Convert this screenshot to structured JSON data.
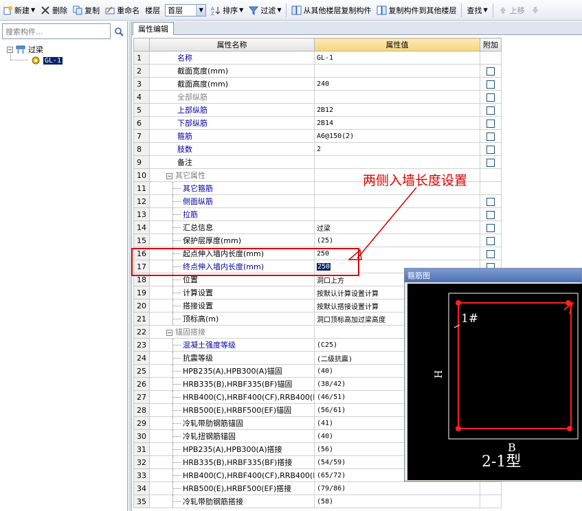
{
  "toolbar": {
    "new_label": "新建",
    "delete_label": "删除",
    "copy_label": "复制",
    "rename_label": "重命名",
    "floor_label": "楼层",
    "floor_value": "首层",
    "sort_label": "排序",
    "filter_label": "过滤",
    "copy_from_label": "从其他楼层复制构件",
    "copy_to_label": "复制构件到其他楼层",
    "find_label": "查找",
    "move_up_label": "上移"
  },
  "left_panel": {
    "search_placeholder": "搜索构件...",
    "tree_root": "过梁",
    "tree_child": "GL-1"
  },
  "tab": {
    "label": "属性编辑"
  },
  "grid": {
    "col_name": "属性名称",
    "col_value": "属性值",
    "col_extra": "附加",
    "rows": [
      {
        "n": "1",
        "name": "名称",
        "value": "GL-1",
        "style": "blue",
        "cb": false
      },
      {
        "n": "2",
        "name": "截面宽度(mm)",
        "value": "",
        "style": "black",
        "cb": true
      },
      {
        "n": "3",
        "name": "截面高度(mm)",
        "value": "240",
        "style": "black",
        "cb": true
      },
      {
        "n": "4",
        "name": "全部纵筋",
        "value": "",
        "style": "grey",
        "cb": true
      },
      {
        "n": "5",
        "name": "上部纵筋",
        "value": "2B12",
        "style": "blue",
        "cb": true
      },
      {
        "n": "6",
        "name": "下部纵筋",
        "value": "2B14",
        "style": "blue",
        "cb": true
      },
      {
        "n": "7",
        "name": "箍筋",
        "value": "A6@150(2)",
        "style": "blue",
        "cb": true
      },
      {
        "n": "8",
        "name": "肢数",
        "value": "2",
        "style": "blue",
        "cb": true
      },
      {
        "n": "9",
        "name": "备注",
        "value": "",
        "style": "black",
        "cb": true
      },
      {
        "n": "10",
        "name": "其它属性",
        "value": "",
        "style": "group",
        "cb": false
      },
      {
        "n": "11",
        "name": "其它箍筋",
        "value": "",
        "style": "blue-sub",
        "cb": false
      },
      {
        "n": "12",
        "name": "侧面纵筋",
        "value": "",
        "style": "blue-sub",
        "cb": true
      },
      {
        "n": "13",
        "name": "拉筋",
        "value": "",
        "style": "blue-sub",
        "cb": true
      },
      {
        "n": "14",
        "name": "汇总信息",
        "value": "过梁",
        "style": "sub",
        "cb": true
      },
      {
        "n": "15",
        "name": "保护层厚度(mm)",
        "value": "(25)",
        "style": "sub",
        "cb": true
      },
      {
        "n": "16",
        "name": "起点伸入墙内长度(mm)",
        "value": "250",
        "style": "sub",
        "cb": true
      },
      {
        "n": "17",
        "name": "终点伸入墙内长度(mm)",
        "value": "250",
        "style": "active",
        "cb": true
      },
      {
        "n": "18",
        "name": "位置",
        "value": "洞口上方",
        "style": "sub",
        "cb": false
      },
      {
        "n": "19",
        "name": "计算设置",
        "value": "按默认计算设置计算",
        "style": "sub",
        "cb": false
      },
      {
        "n": "20",
        "name": "搭接设置",
        "value": "按默认搭接设置计算",
        "style": "sub",
        "cb": false
      },
      {
        "n": "21",
        "name": "顶标高(m)",
        "value": "洞口顶标高加过梁高度",
        "style": "sub",
        "cb": false
      },
      {
        "n": "22",
        "name": "锚固搭接",
        "value": "",
        "style": "group",
        "cb": false
      },
      {
        "n": "23",
        "name": "混凝土强度等级",
        "value": "(C25)",
        "style": "blue-sub",
        "cb": false
      },
      {
        "n": "24",
        "name": "抗震等级",
        "value": "(二级抗震)",
        "style": "sub",
        "cb": false
      },
      {
        "n": "25",
        "name": "HPB235(A),HPB300(A)锚固",
        "value": "(40)",
        "style": "sub",
        "cb": false
      },
      {
        "n": "26",
        "name": "HRB335(B),HRBF335(BF)锚固",
        "value": "(38/42)",
        "style": "sub",
        "cb": false
      },
      {
        "n": "27",
        "name": "HRB400(C),HRBF400(CF),RRB400(D)锚",
        "value": "(46/51)",
        "style": "sub",
        "cb": false
      },
      {
        "n": "28",
        "name": "HRB500(E),HRBF500(EF)锚固",
        "value": "(56/61)",
        "style": "sub",
        "cb": false
      },
      {
        "n": "29",
        "name": "冷轧带肋钢筋锚固",
        "value": "(41)",
        "style": "sub",
        "cb": false
      },
      {
        "n": "30",
        "name": "冷轧扭钢筋锚固",
        "value": "(40)",
        "style": "sub",
        "cb": false
      },
      {
        "n": "31",
        "name": "HPB235(A),HPB300(A)搭接",
        "value": "(56)",
        "style": "sub",
        "cb": false
      },
      {
        "n": "32",
        "name": "HRB335(B),HRBF335(BF)搭接",
        "value": "(54/59)",
        "style": "sub",
        "cb": false
      },
      {
        "n": "33",
        "name": "HRB400(C),HRBF400(CF),RRB400(D)搭",
        "value": "(65/72)",
        "style": "sub",
        "cb": false
      },
      {
        "n": "34",
        "name": "HRB500(E),HRBF500(EF)搭接",
        "value": "(79/86)",
        "style": "sub",
        "cb": false
      },
      {
        "n": "35",
        "name": "冷轧带肋钢筋搭接",
        "value": "(58)",
        "style": "sub",
        "cb": false
      }
    ]
  },
  "annotation": {
    "text": "两侧入墙长度设置",
    "color": "#e00000"
  },
  "stirrup": {
    "title": "箍筋图",
    "rebar_label": "1#",
    "height_label": "H",
    "width_label": "B",
    "type_label": "2-1型",
    "frame_color": "#ff2020"
  }
}
